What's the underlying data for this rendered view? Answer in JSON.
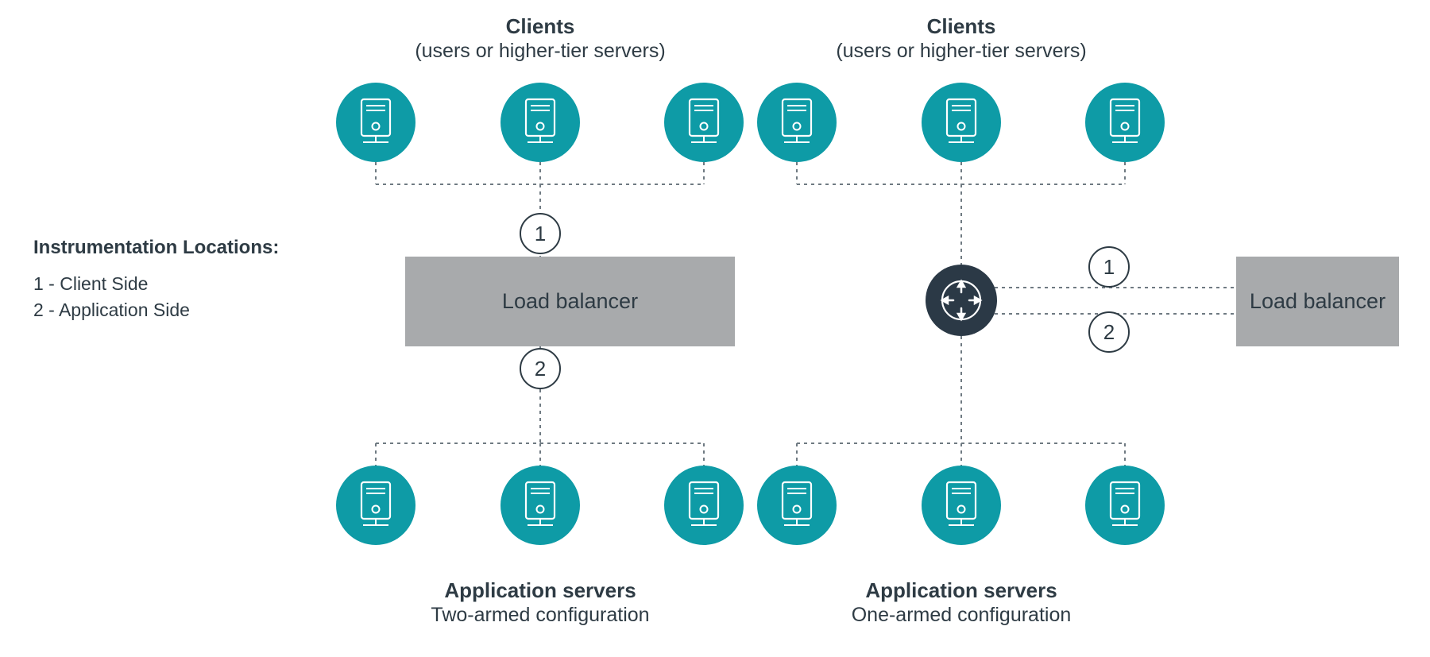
{
  "legend": {
    "title": "Instrumentation Locations:",
    "line1": "1 - Client Side",
    "line2": "2 - Application Side"
  },
  "markers": {
    "one": "1",
    "two": "2"
  },
  "left": {
    "clients_title": "Clients",
    "clients_sub": "(users or higher-tier servers)",
    "lb": "Load balancer",
    "servers_title": "Application servers",
    "config": "Two-armed configuration"
  },
  "right": {
    "clients_title": "Clients",
    "clients_sub": "(users or higher-tier servers)",
    "lb": "Load balancer",
    "servers_title": "Application servers",
    "config": "One-armed configuration"
  },
  "icons": {
    "server": "server-icon",
    "router": "router-icon"
  },
  "colors": {
    "teal": "#0e9ba6",
    "dark": "#2b3946",
    "grey": "#a8aaac",
    "ink": "#2e3b44"
  }
}
